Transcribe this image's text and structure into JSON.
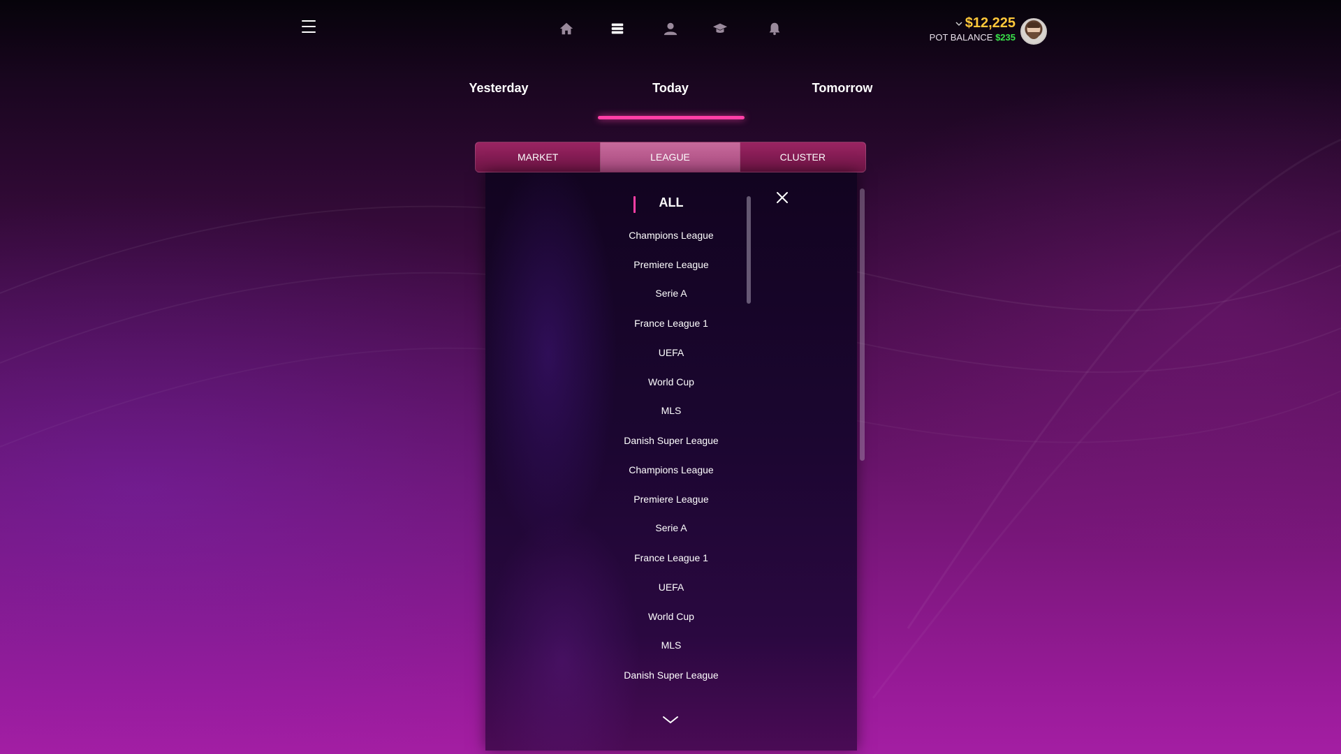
{
  "header": {
    "nav_icons": [
      "home-icon",
      "list-icon",
      "user-icon",
      "graduation-cap-icon",
      "bell-icon"
    ],
    "balance": "$12,225",
    "pot_label": "POT BALANCE",
    "pot_amount": "$235"
  },
  "day_tabs": {
    "yesterday": "Yesterday",
    "today": "Today",
    "tomorrow": "Tomorrow",
    "active": "Today"
  },
  "segments": {
    "market": "MARKET",
    "league": "LEAGUE",
    "cluster": "CLUSTER",
    "active": "LEAGUE"
  },
  "dropdown": {
    "all_label": "ALL",
    "items": [
      "Champions League",
      "Premiere League",
      "Serie A",
      "France League 1",
      "UEFA",
      "World Cup",
      "MLS",
      "Danish Super League",
      "Champions League",
      "Premiere League",
      "Serie A",
      "France League 1",
      "UEFA",
      "World Cup",
      "MLS",
      "Danish Super League"
    ]
  },
  "colors": {
    "accent_pink": "#ff3fa6",
    "balance_gold": "#ffc83a",
    "pot_green": "#39e34a"
  }
}
